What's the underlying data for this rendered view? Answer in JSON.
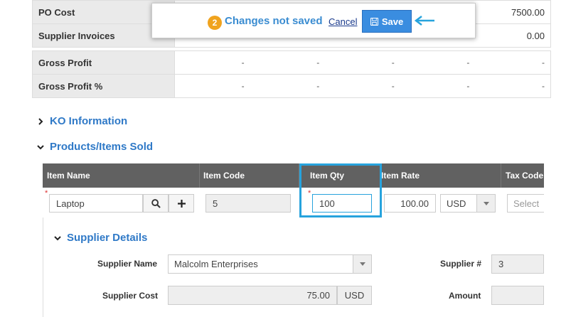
{
  "summary": {
    "po_cost": {
      "label": "PO Cost",
      "value": "7500.00"
    },
    "supplier_invoices": {
      "label": "Supplier Invoices",
      "value": "0.00"
    },
    "gross_profit": {
      "label": "Gross Profit",
      "values": [
        "-",
        "-",
        "-",
        "-",
        "-"
      ]
    },
    "gross_profit_pct": {
      "label": "Gross Profit %",
      "values": [
        "-",
        "-",
        "-",
        "-",
        "-"
      ]
    }
  },
  "popup": {
    "badge_count": "2",
    "message": "Changes not saved",
    "cancel_label": "Cancel",
    "save_label": "Save"
  },
  "sections": {
    "ko_info": "KO Information",
    "products_sold": "Products/Items Sold",
    "supplier_details": "Supplier Details"
  },
  "grid": {
    "columns": [
      "Item Name",
      "Item Code",
      "Item Qty",
      "Item Rate",
      "Tax Code"
    ],
    "row": {
      "item_name": "Laptop",
      "item_code": "5",
      "item_qty": "100",
      "item_rate": "100.00",
      "currency": "USD",
      "tax_placeholder": "Select"
    }
  },
  "supplier": {
    "name_label": "Supplier Name",
    "name_value": "Malcolm Enterprises",
    "number_label": "Supplier #",
    "number_value": "3",
    "cost_label": "Supplier Cost",
    "cost_value": "75.00",
    "cost_currency": "USD",
    "amount_label": "Amount"
  }
}
